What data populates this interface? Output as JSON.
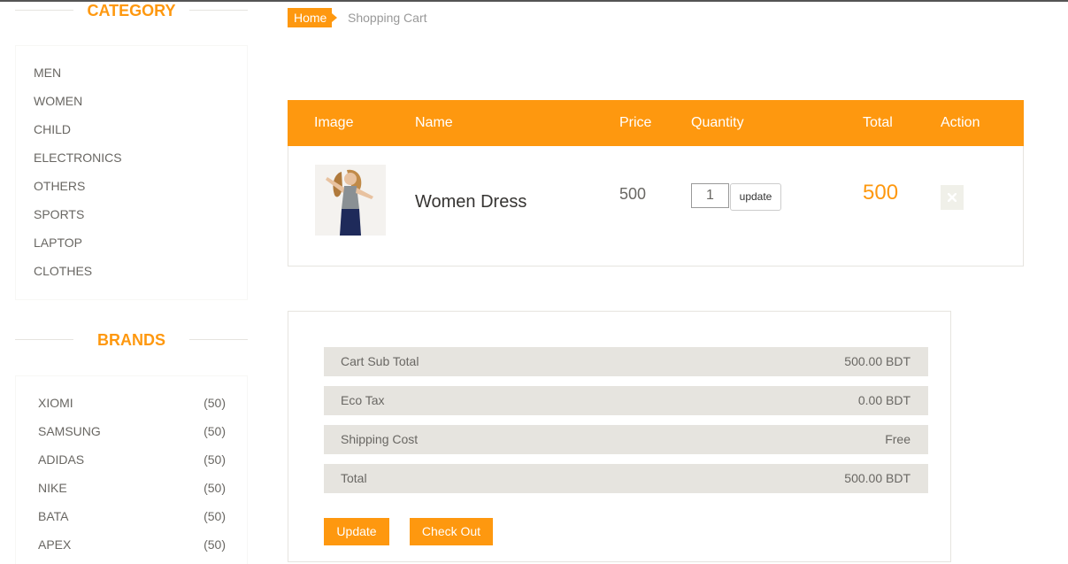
{
  "sidebar": {
    "category_heading": "CATEGORY",
    "categories": [
      "MEN",
      "WOMEN",
      "CHILD",
      "ELECTRONICS",
      "OTHERS",
      "SPORTS",
      "LAPTOP",
      "CLOTHES"
    ],
    "brands_heading": "BRANDS",
    "brands": [
      {
        "name": "XIOMI",
        "count": "(50)"
      },
      {
        "name": "SAMSUNG",
        "count": "(50)"
      },
      {
        "name": "ADIDAS",
        "count": "(50)"
      },
      {
        "name": "NIKE",
        "count": "(50)"
      },
      {
        "name": "BATA",
        "count": "(50)"
      },
      {
        "name": "APEX",
        "count": "(50)"
      }
    ]
  },
  "breadcrumb": {
    "home": "Home",
    "current": "Shopping Cart"
  },
  "cart": {
    "headers": {
      "image": "Image",
      "name": "Name",
      "price": "Price",
      "quantity": "Quantity",
      "total": "Total",
      "action": "Action"
    },
    "items": [
      {
        "name": "Women Dress",
        "price": "500",
        "quantity": "1",
        "update_label": "update",
        "total": "500",
        "delete_icon": "close-icon"
      }
    ]
  },
  "summary": {
    "rows": [
      {
        "label": "Cart Sub Total",
        "value": "500.00 BDT"
      },
      {
        "label": "Eco Tax",
        "value": "0.00 BDT"
      },
      {
        "label": "Shipping Cost",
        "value": "Free"
      },
      {
        "label": "Total",
        "value": "500.00 BDT"
      }
    ],
    "update_button": "Update",
    "checkout_button": "Check Out"
  },
  "colors": {
    "accent": "#fe980f",
    "row_bg": "#e6e4df",
    "text": "#696763"
  }
}
